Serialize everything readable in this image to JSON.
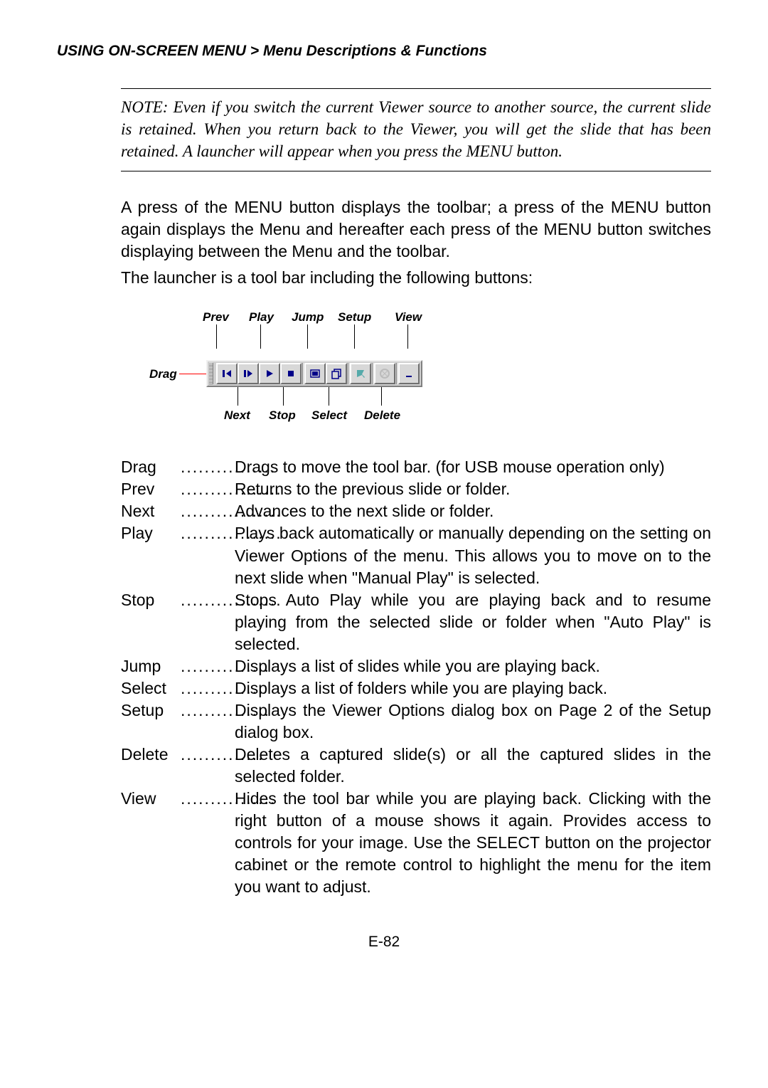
{
  "header": "USING ON-SCREEN MENU > Menu Descriptions & Functions",
  "note": "NOTE: Even if you switch the current Viewer source to another source, the current slide is retained. When you return back to the Viewer, you will get the slide that has been retained. A launcher will appear when you press the MENU button.",
  "para1": "A press of the MENU button displays the toolbar; a press of the MENU button again displays the Menu and hereafter each press of the MENU button switches displaying between the Menu and the toolbar.",
  "para2": "The launcher is a tool bar including the following buttons:",
  "labels": {
    "drag": "Drag",
    "prev": "Prev",
    "next": "Next",
    "play": "Play",
    "stop": "Stop",
    "jump": "Jump",
    "select": "Select",
    "setup": "Setup",
    "delete": "Delete",
    "view": "View"
  },
  "defs": [
    {
      "term": "Drag",
      "dots": "................",
      "desc": "Drags to move the tool bar. (for USB mouse operation only)"
    },
    {
      "term": "Prev",
      "dots": ".................",
      "desc": "Returns to the previous slide or folder."
    },
    {
      "term": "Next",
      "dots": ".................",
      "desc": "Advances to the next slide or folder."
    },
    {
      "term": "Play",
      "dots": ".................",
      "desc": "Plays back automatically or manually depending on the setting on Viewer Options of the menu. This allows you to move on to the next slide when \"Manual Play\" is selected."
    },
    {
      "term": "Stop",
      "dots": ".................",
      "desc": "Stops Auto Play while you are playing back and to resume playing from the selected slide or folder when \"Auto Play\" is selected."
    },
    {
      "term": "Jump",
      "dots": "...............",
      "desc": "Displays a list of slides while you are playing back."
    },
    {
      "term": "Select",
      "dots": "..............",
      "desc": "Displays a list of folders while you are playing back."
    },
    {
      "term": "Setup",
      "dots": "...............",
      "desc": "Displays the Viewer Options dialog box on Page 2 of the Setup dialog box."
    },
    {
      "term": "Delete",
      "dots": "..............",
      "desc": "Deletes a captured slide(s) or all the captured slides in the selected folder."
    },
    {
      "term": "View",
      "dots": "................",
      "desc": "Hides the tool bar while you are playing back. Clicking with the right button of a mouse shows it again. Provides access to controls for your image. Use the SELECT button on the projector cabinet or the remote control to highlight the menu for the item you want to adjust."
    }
  ],
  "footer": "E-82"
}
